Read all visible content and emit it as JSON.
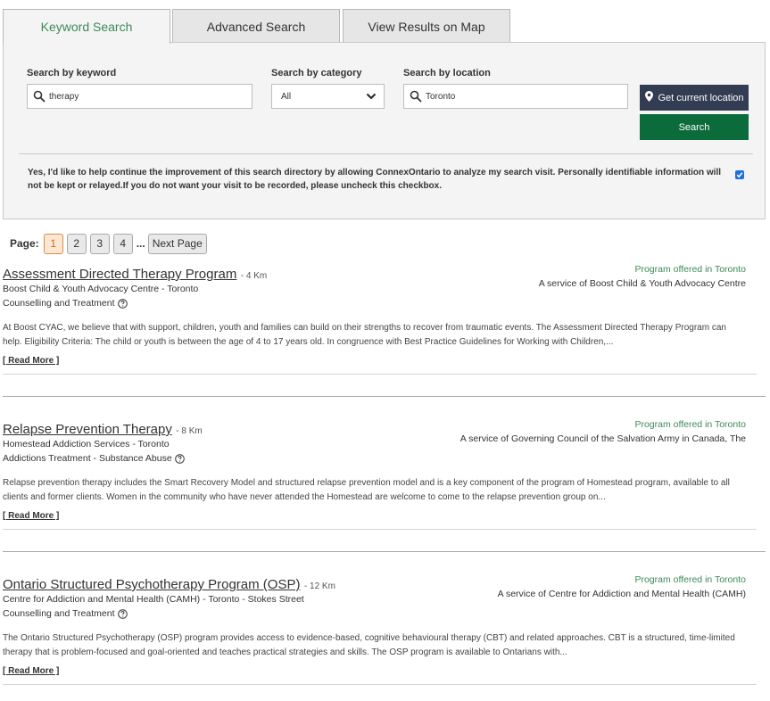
{
  "tabs": [
    {
      "label": "Keyword Search",
      "active": true
    },
    {
      "label": "Advanced Search",
      "active": false
    },
    {
      "label": "View Results on Map",
      "active": false
    }
  ],
  "search": {
    "keyword_label": "Search by keyword",
    "keyword_value": "therapy",
    "category_label": "Search by category",
    "category_value": "All",
    "location_label": "Search by location",
    "location_value": "Toronto",
    "get_location_label": "Get current location",
    "search_label": "Search",
    "consent_text": "Yes, I'd like to help continue the improvement of this search directory by allowing ConnexOntario to analyze my search visit. Personally identifiable information will not be kept or relayed.If you do not want your visit to be recorded, please uncheck this checkbox.",
    "consent_checked": true
  },
  "pager": {
    "label": "Page:",
    "pages": [
      "1",
      "2",
      "3",
      "4"
    ],
    "current": "1",
    "ellipsis": "...",
    "next_label": "Next Page"
  },
  "results": [
    {
      "title": "Assessment Directed Therapy Program",
      "distance": "- 4 Km",
      "org": "Boost Child & Youth Advocacy Centre - Toronto",
      "category": "Counselling and Treatment",
      "offered": "Program offered in Toronto",
      "service": "A service of Boost Child & Youth Advocacy Centre",
      "description": "At Boost CYAC, we believe that with support, children, youth and families can build on their strengths to recover from traumatic events. The Assessment Directed Therapy Program can help. Eligibility Criteria: The child or youth is between the age of 4 to 17 years old. In congruence with Best Practice Guidelines for Working with Children,...",
      "read_more": "[ Read More ]"
    },
    {
      "title": "Relapse Prevention Therapy",
      "distance": "- 8 Km",
      "org": "Homestead Addiction Services - Toronto",
      "category": "Addictions Treatment - Substance Abuse",
      "offered": "Program offered in Toronto",
      "service": "A service of Governing Council of the Salvation Army in Canada, The",
      "description": "Relapse prevention therapy includes the Smart Recovery Model and structured relapse prevention model and is a key component of the program of Homestead program, available to all clients and former clients. Women in the community who have never attended the Homestead are welcome to come to the relapse prevention group on...",
      "read_more": "[ Read More ]"
    },
    {
      "title": "Ontario Structured Psychotherapy Program (OSP)",
      "distance": "- 12 Km",
      "org": "Centre for Addiction and Mental Health (CAMH) - Toronto - Stokes Street",
      "category": "Counselling and Treatment",
      "offered": "Program offered in Toronto",
      "service": "A service of Centre for Addiction and Mental Health (CAMH)",
      "description": "The Ontario Structured Psychotherapy (OSP) program provides access to evidence-based, cognitive behavioural therapy (CBT) and related approaches. CBT is a structured, time-limited therapy that is problem-focused and goal-oriented and teaches practical strategies and skills. The OSP program is available to Ontarians with...",
      "read_more": "[ Read More ]"
    }
  ],
  "colors": {
    "accent_green": "#3d8a58",
    "search_button": "#0c6b3b",
    "location_button": "#323c52",
    "active_page": "#e08a3c"
  }
}
